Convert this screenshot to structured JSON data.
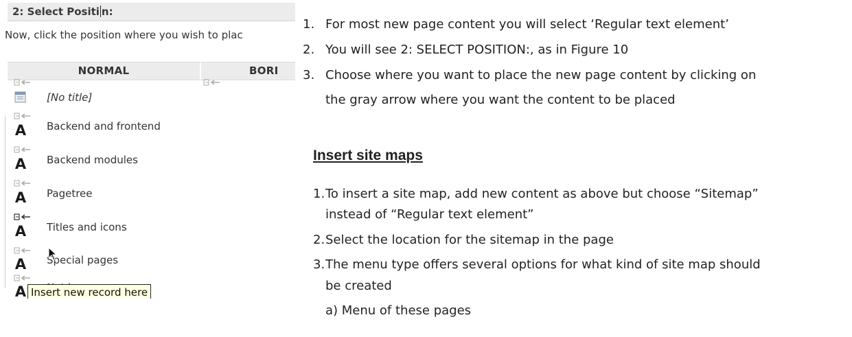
{
  "screenshot": {
    "section_heading_before_caret": "2: Select Positi",
    "section_heading_after_caret": "n:",
    "instruction": "Now, click the position where you wish to plac",
    "columns": {
      "normal": "NORMAL",
      "border": "BORI"
    },
    "records": [
      {
        "label": "[No title]",
        "icon": "page-icon"
      },
      {
        "label": "Backend and frontend",
        "icon": "text-element-icon"
      },
      {
        "label": "Backend modules",
        "icon": "text-element-icon"
      },
      {
        "label": "Pagetree",
        "icon": "text-element-icon"
      },
      {
        "label": "Titles and icons",
        "icon": "text-element-icon"
      },
      {
        "label": "Special pages",
        "icon": "text-element-icon"
      },
      {
        "label": "Not in menu",
        "icon": "text-element-icon"
      }
    ],
    "record_icon_glyph": "A",
    "tooltip": "Insert new record here"
  },
  "doc": {
    "list1": [
      {
        "num": "1.",
        "text": "For most new page content you will select ‘Regular text element’"
      },
      {
        "num": "2.",
        "text": "You will see 2: SELECT POSITION:, as in Figure 10"
      },
      {
        "num": "3.",
        "text": "Choose where you want to place the new page content by clicking on"
      }
    ],
    "list1_item3_cont": "the gray arrow where you want the content to be placed",
    "heading": "Insert site maps",
    "list2": [
      {
        "num": "1.",
        "text": "To insert a site map, add new content as above but choose “Sitemap”"
      },
      {
        "num": "2.",
        "text": "Select the location for the sitemap in the page"
      },
      {
        "num": "3.",
        "text": "The menu type offers several options for what kind of site map should"
      }
    ],
    "list2_item1_cont": "instead of “Regular text element”",
    "list2_item3_cont": "be created",
    "sub_a": "a)  Menu of these pages"
  }
}
